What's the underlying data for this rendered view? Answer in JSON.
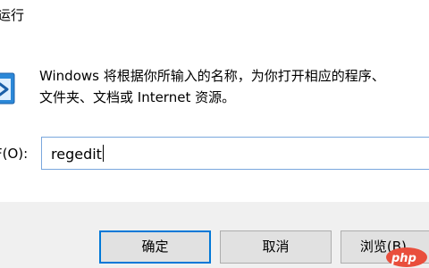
{
  "window": {
    "title": "运行"
  },
  "dialog": {
    "description_line1": "Windows 将根据你所输入的名称，为你打开相应的程序、",
    "description_line2": "文件夹、文档或 Internet 资源。",
    "open_label": "F(O):",
    "open_value": "regedit"
  },
  "buttons": {
    "ok_label": "确定",
    "cancel_label": "取消",
    "browse_label": "浏览(B)..."
  },
  "watermark": {
    "text": "php",
    "color": "#e94e3c"
  },
  "colors": {
    "focus_accent": "#0078d7",
    "input_border": "#7aa7dd",
    "footer_bg": "#f0f0f0"
  }
}
